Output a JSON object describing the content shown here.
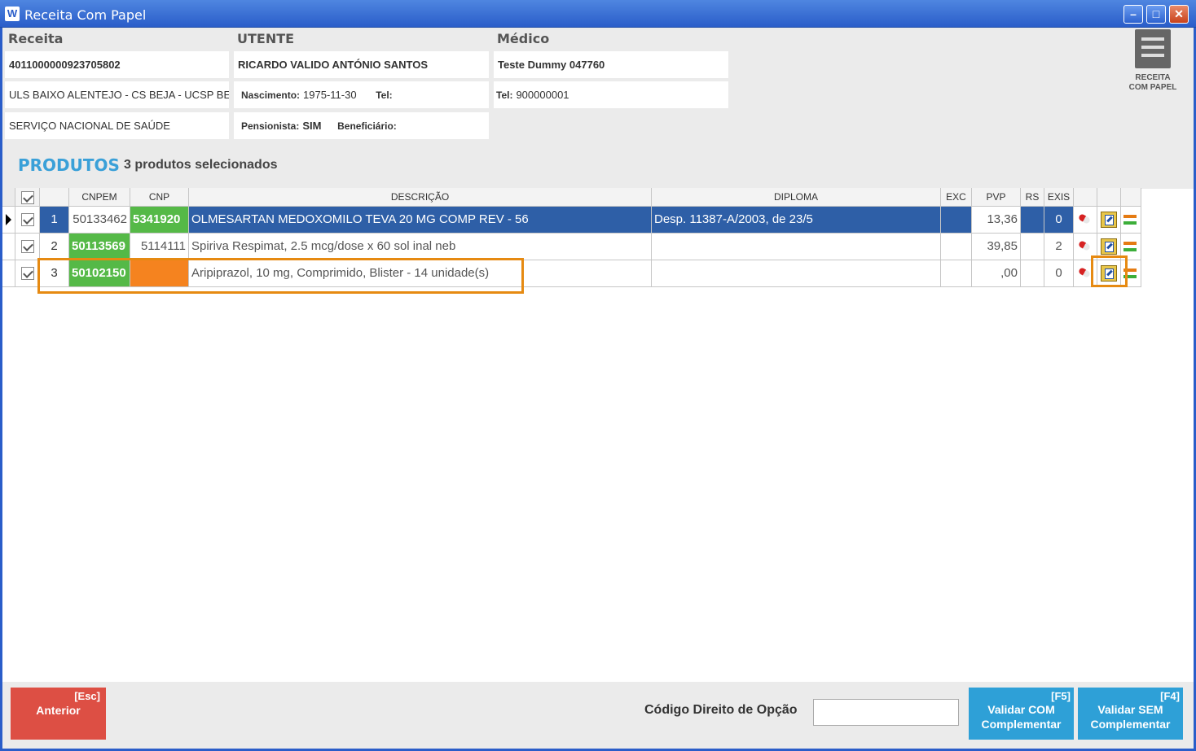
{
  "window": {
    "title": "Receita Com Papel",
    "app_icon": "W"
  },
  "sections": {
    "receita": "Receita",
    "utente": "UTENTE",
    "medico": "Médico"
  },
  "receita": {
    "number": "4011000000923705802",
    "location": "ULS BAIXO ALENTEJO - CS BEJA - UCSP BE",
    "entity": "SERVIÇO NACIONAL DE SAÚDE"
  },
  "utente": {
    "name": "RICARDO VALIDO ANTÓNIO SANTOS",
    "nascimento_label": "Nascimento:",
    "nascimento": "1975-11-30",
    "tel_label": "Tel:",
    "tel": "",
    "pensionista_label": "Pensionista:",
    "pensionista": "SIM",
    "beneficiario_label": "Beneficiário:",
    "beneficiario": ""
  },
  "medico": {
    "name": "Teste Dummy 047760",
    "tel_label": "Tel:",
    "tel": "900000001"
  },
  "receita_button": {
    "line1": "RECEITA",
    "line2": "COM PAPEL"
  },
  "produtos": {
    "title": "PRODUTOS",
    "count_text": "3 produtos selecionados"
  },
  "table": {
    "headers": {
      "cnpem": "CNPEM",
      "cnp": "CNP",
      "descricao": "DESCRIÇÃO",
      "diploma": "DIPLOMA",
      "exc": "EXC",
      "pvp": "PVP",
      "rs": "RS",
      "exis": "EXIS"
    },
    "rows": [
      {
        "n": "1",
        "cnpem": "50133462",
        "cnp": "5341920",
        "descricao": "OLMESARTAN MEDOXOMILO TEVA 20 MG COMP REV    - 56",
        "diploma": "Desp. 11387-A/2003, de 23/5",
        "exc": "",
        "pvp": "13,36",
        "rs": "",
        "exis": "0"
      },
      {
        "n": "2",
        "cnpem": "50113569",
        "cnp": "5114111",
        "descricao": "Spiriva Respimat, 2.5 mcg/dose x 60 sol inal neb",
        "diploma": "",
        "exc": "",
        "pvp": "39,85",
        "rs": "",
        "exis": "2"
      },
      {
        "n": "3",
        "cnpem": "50102150",
        "cnp": "",
        "descricao": "Aripiprazol, 10 mg, Comprimido, Blister - 14 unidade(s)",
        "diploma": "",
        "exc": "",
        "pvp": ",00",
        "rs": "",
        "exis": "0"
      }
    ]
  },
  "footer": {
    "anterior_key": "[Esc]",
    "anterior_label": "Anterior",
    "codigo_label": "Código Direito de Opção",
    "codigo_value": "",
    "validar_com_key": "[F5]",
    "validar_com_line1": "Validar COM",
    "validar_com_line2": "Complementar",
    "validar_sem_key": "[F4]",
    "validar_sem_line1": "Validar SEM",
    "validar_sem_line2": "Complementar"
  },
  "colors": {
    "accent_blue": "#2ea0d7",
    "selected_row": "#2e5fa7",
    "green": "#55b947",
    "orange": "#f5831f",
    "red": "#dd4f44",
    "highlight": "#e68a12"
  }
}
